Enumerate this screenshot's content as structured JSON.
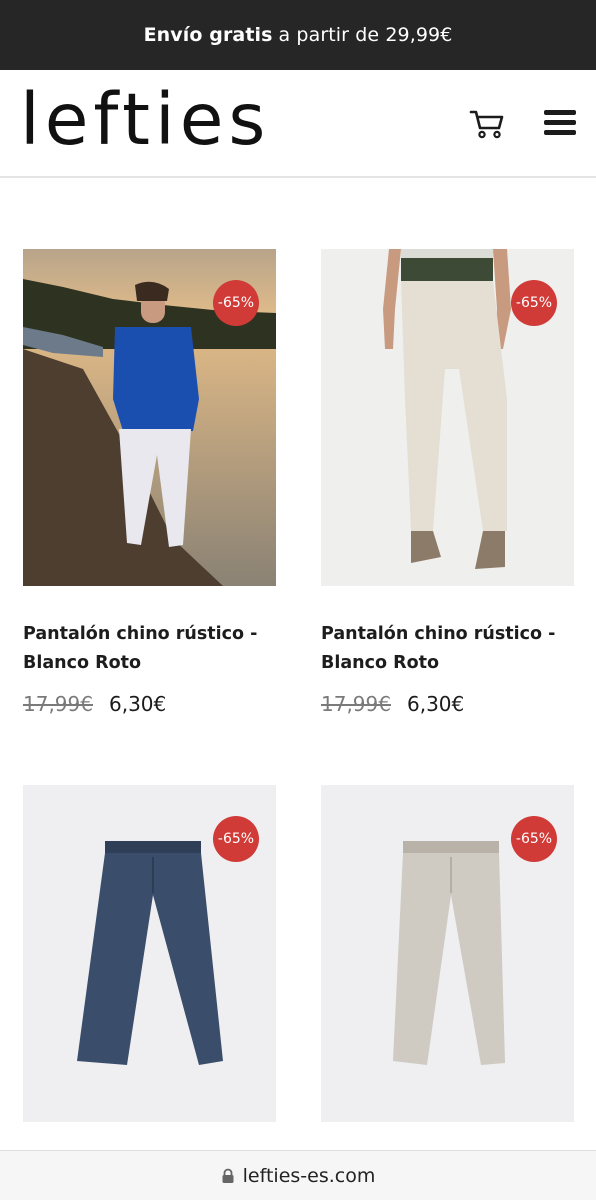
{
  "promo": {
    "bold": "Envío gratis",
    "rest": "a partir de 29,99€"
  },
  "header": {
    "logo": "lefties",
    "cart_icon": "shopping-cart-icon",
    "menu_icon": "hamburger-menu-icon"
  },
  "products": [
    {
      "discount": "-65%",
      "name": "Pantalón chino rústico - Blanco Roto",
      "old_price": "17,99€",
      "new_price": "6,30€"
    },
    {
      "discount": "-65%",
      "name": "Pantalón chino rústico - Blanco Roto",
      "old_price": "17,99€",
      "new_price": "6,30€"
    },
    {
      "discount": "-65%"
    },
    {
      "discount": "-65%"
    }
  ],
  "browser": {
    "url": "lefties-es.com",
    "lock_icon": "lock-icon"
  },
  "colors": {
    "promo_bg": "#262626",
    "badge": "#d03a37",
    "url_bar_bg": "#f6f6f6"
  }
}
